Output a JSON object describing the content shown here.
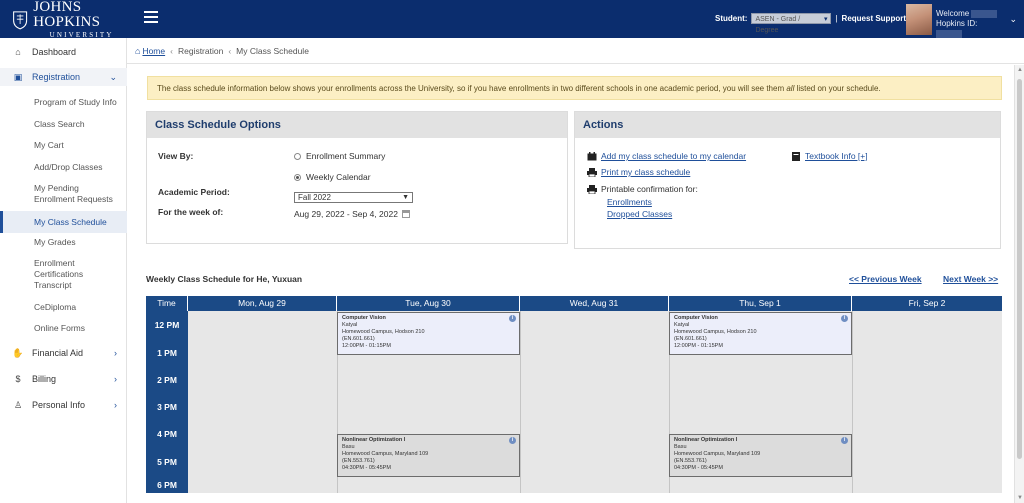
{
  "header": {
    "logo_text": "JOHNS HOPKINS",
    "logo_subtext": "UNIVERSITY",
    "student_label": "Student:",
    "student_select": "ASEN - Grad / Degree",
    "request_support": "Request Support",
    "welcome_label": "Welcome",
    "hopkins_id_label": "Hopkins ID:"
  },
  "sidebar": {
    "dashboard": "Dashboard",
    "registration": "Registration",
    "items": [
      "Program of Study Info",
      "Class Search",
      "My Cart",
      "Add/Drop Classes",
      "My Pending Enrollment Requests",
      "My Class Schedule",
      "My Grades",
      "Enrollment Certifications Transcript",
      "CeDiploma",
      "Online Forms"
    ],
    "financial_aid": "Financial Aid",
    "billing": "Billing",
    "personal_info": "Personal Info"
  },
  "breadcrumb": {
    "home": "Home",
    "registration": "Registration",
    "current": "My Class Schedule"
  },
  "notice": {
    "before": "The class schedule information below shows your enrollments across the University, so if you have enrollments in two different schools in one academic period, you will see them ",
    "emph": "all",
    "after": " listed on your schedule."
  },
  "options": {
    "title": "Class Schedule Options",
    "view_by_label": "View By:",
    "enrollment_summary": "Enrollment Summary",
    "weekly_calendar": "Weekly Calendar",
    "selected_view": "weekly_calendar",
    "academic_period_label": "Academic Period:",
    "academic_period_value": "Fall 2022",
    "week_label": "For the week of:",
    "week_value": "Aug 29, 2022 - Sep 4, 2022"
  },
  "actions": {
    "title": "Actions",
    "add_calendar": "Add my class schedule to my calendar",
    "print_schedule": "Print my class schedule",
    "printable_confirmation": "Printable confirmation for:",
    "enrollments": "Enrollments",
    "dropped_classes": "Dropped Classes",
    "textbook": "Textbook Info [+]"
  },
  "schedule": {
    "title": "Weekly Class Schedule for He, Yuxuan",
    "prev_week": "<<  Previous Week",
    "next_week": "Next Week  >>",
    "time_header": "Time",
    "days": [
      "Mon, Aug 29",
      "Tue, Aug 30",
      "Wed, Aug 31",
      "Thu, Sep 1",
      "Fri, Sep 2"
    ],
    "times": [
      "12 PM",
      "1 PM",
      "2 PM",
      "3 PM",
      "4 PM",
      "5 PM",
      "6 PM"
    ],
    "events": [
      {
        "day": "Tue, Aug 30",
        "title": "Computer Vision",
        "instructor": "Katyal",
        "location": "Homewood Campus, Hodson 210",
        "code": "(EN.601.661)",
        "time": "12:00PM - 01:15PM",
        "style": "blue"
      },
      {
        "day": "Thu, Sep 1",
        "title": "Computer Vision",
        "instructor": "Katyal",
        "location": "Homewood Campus, Hodson 210",
        "code": "(EN.601.661)",
        "time": "12:00PM - 01:15PM",
        "style": "blue"
      },
      {
        "day": "Tue, Aug 30",
        "title": "Nonlinear Optimization I",
        "instructor": "Basu",
        "location": "Homewood Campus, Maryland 109",
        "code": "(EN.553.761)",
        "time": "04:30PM - 05:45PM",
        "style": "gray"
      },
      {
        "day": "Thu, Sep 1",
        "title": "Nonlinear Optimization I",
        "instructor": "Basu",
        "location": "Homewood Campus, Maryland 109",
        "code": "(EN.553.761)",
        "time": "04:30PM - 05:45PM",
        "style": "gray"
      }
    ]
  },
  "colors": {
    "header_bg": "#0b2d6e",
    "calendar_header": "#1b4a86",
    "link": "#1f4f9a",
    "notice_bg": "#fcefc4",
    "event_blue": "#eceefa",
    "event_gray": "#dcdcdc"
  }
}
